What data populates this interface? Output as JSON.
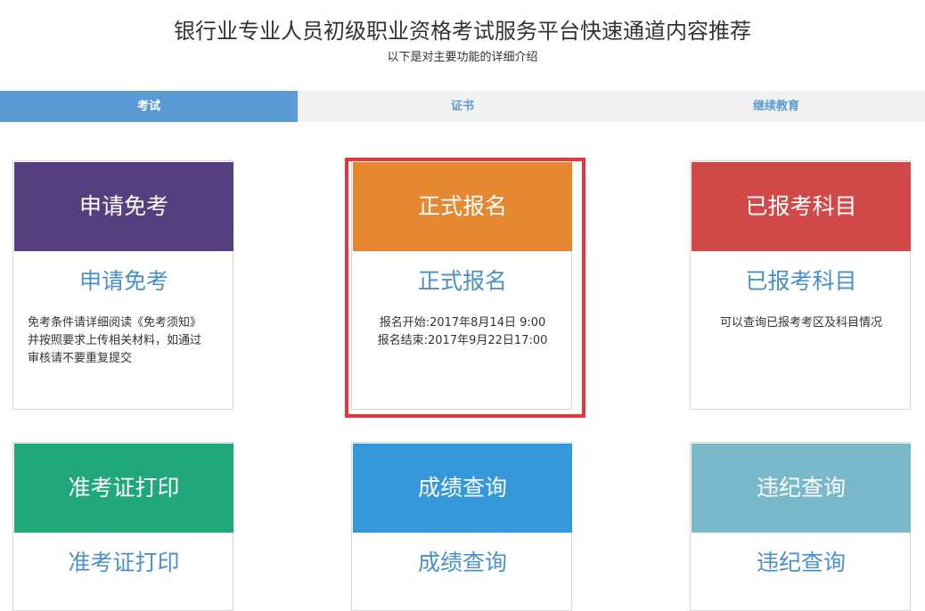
{
  "header": {
    "title": "银行业专业人员初级职业资格考试服务平台快速通道内容推荐",
    "subtitle": "以下是对主要功能的详细介绍"
  },
  "tabs": [
    {
      "label": "考试",
      "active": true
    },
    {
      "label": "证书",
      "active": false
    },
    {
      "label": "继续教育",
      "active": false
    }
  ],
  "cards": [
    {
      "head": "申请免考",
      "sub": "申请免考",
      "desc": "免考条件请详细阅读《免考须知》\n并按照要求上传相关材料，如通过\n审核请不要重复提交",
      "color": "#553f7f"
    },
    {
      "head": "正式报名",
      "sub": "正式报名",
      "desc": "报名开始:2017年8月14日 9:00\n报名结束:2017年9月22日17:00",
      "color": "#e68731"
    },
    {
      "head": "已报考科目",
      "sub": "已报考科目",
      "desc": "可以查询已报考考区及科目情况",
      "color": "#d04848"
    },
    {
      "head": "准考证打印",
      "sub": "准考证打印",
      "desc": "",
      "color": "#21a87a"
    },
    {
      "head": "成绩查询",
      "sub": "成绩查询",
      "desc": "",
      "color": "#3498db"
    },
    {
      "head": "违纪查询",
      "sub": "违纪查询",
      "desc": "",
      "color": "#79b9c9"
    }
  ],
  "colors": {
    "accent": "#5b9bd5",
    "link": "#4a90c9",
    "highlight": "#e8343a"
  }
}
